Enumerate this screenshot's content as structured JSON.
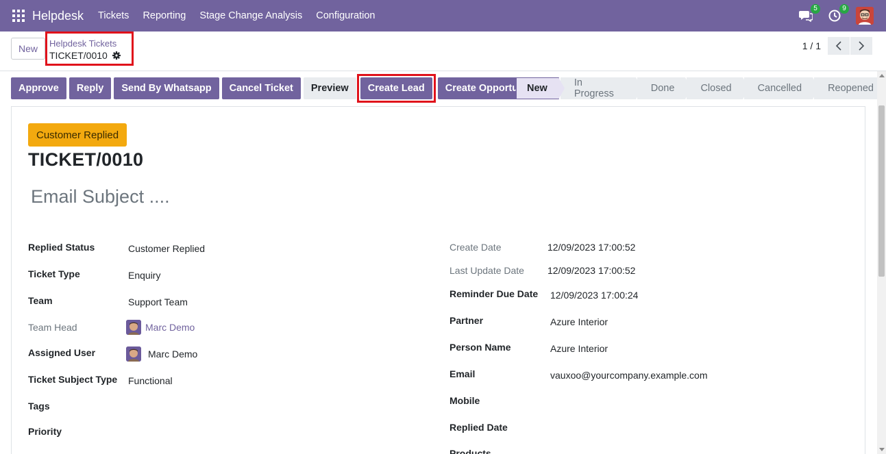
{
  "navbar": {
    "app_name": "Helpdesk",
    "menu": [
      "Tickets",
      "Reporting",
      "Stage Change Analysis",
      "Configuration"
    ],
    "messages_count": "5",
    "activities_count": "9"
  },
  "control_panel": {
    "new_label": "New",
    "breadcrumb_parent": "Helpdesk Tickets",
    "breadcrumb_current": "TICKET/0010",
    "pager_value": "1 / 1"
  },
  "actions": {
    "approve": "Approve",
    "reply": "Reply",
    "send_whatsapp": "Send By Whatsapp",
    "cancel_ticket": "Cancel Ticket",
    "preview": "Preview",
    "create_lead": "Create Lead",
    "create_opportunity": "Create Opportunity"
  },
  "stages": [
    "New",
    "In Progress",
    "Done",
    "Closed",
    "Cancelled",
    "Reopened"
  ],
  "active_stage": "New",
  "form": {
    "replied_tag": "Customer Replied",
    "ticket_name": "TICKET/0010",
    "email_subject_placeholder": "Email Subject ....",
    "left": {
      "replied_status": {
        "label": "Replied Status",
        "value": "Customer Replied"
      },
      "ticket_type": {
        "label": "Ticket Type",
        "value": "Enquiry"
      },
      "team": {
        "label": "Team",
        "value": "Support Team"
      },
      "team_head": {
        "label": "Team Head",
        "value": "Marc Demo"
      },
      "assigned_user": {
        "label": "Assigned User",
        "value": "Marc Demo"
      },
      "ticket_subject_type": {
        "label": "Ticket Subject Type",
        "value": "Functional"
      },
      "tags": {
        "label": "Tags",
        "value": ""
      },
      "priority": {
        "label": "Priority",
        "value": ""
      }
    },
    "right": {
      "create_date": {
        "label": "Create Date",
        "value": "12/09/2023 17:00:52"
      },
      "last_update_date": {
        "label": "Last Update Date",
        "value": "12/09/2023 17:00:52"
      },
      "reminder_due_date": {
        "label": "Reminder Due Date",
        "value": "12/09/2023 17:00:24"
      },
      "partner": {
        "label": "Partner",
        "value": "Azure Interior"
      },
      "person_name": {
        "label": "Person Name",
        "value": "Azure Interior"
      },
      "email": {
        "label": "Email",
        "value": "vauxoo@yourcompany.example.com"
      },
      "mobile": {
        "label": "Mobile",
        "value": ""
      },
      "replied_date": {
        "label": "Replied Date",
        "value": ""
      },
      "products": {
        "label": "Products",
        "value": ""
      }
    }
  },
  "colors": {
    "brand": "#71639e",
    "highlight_border": "#e0121b",
    "tag_warning": "#f3a90f"
  }
}
